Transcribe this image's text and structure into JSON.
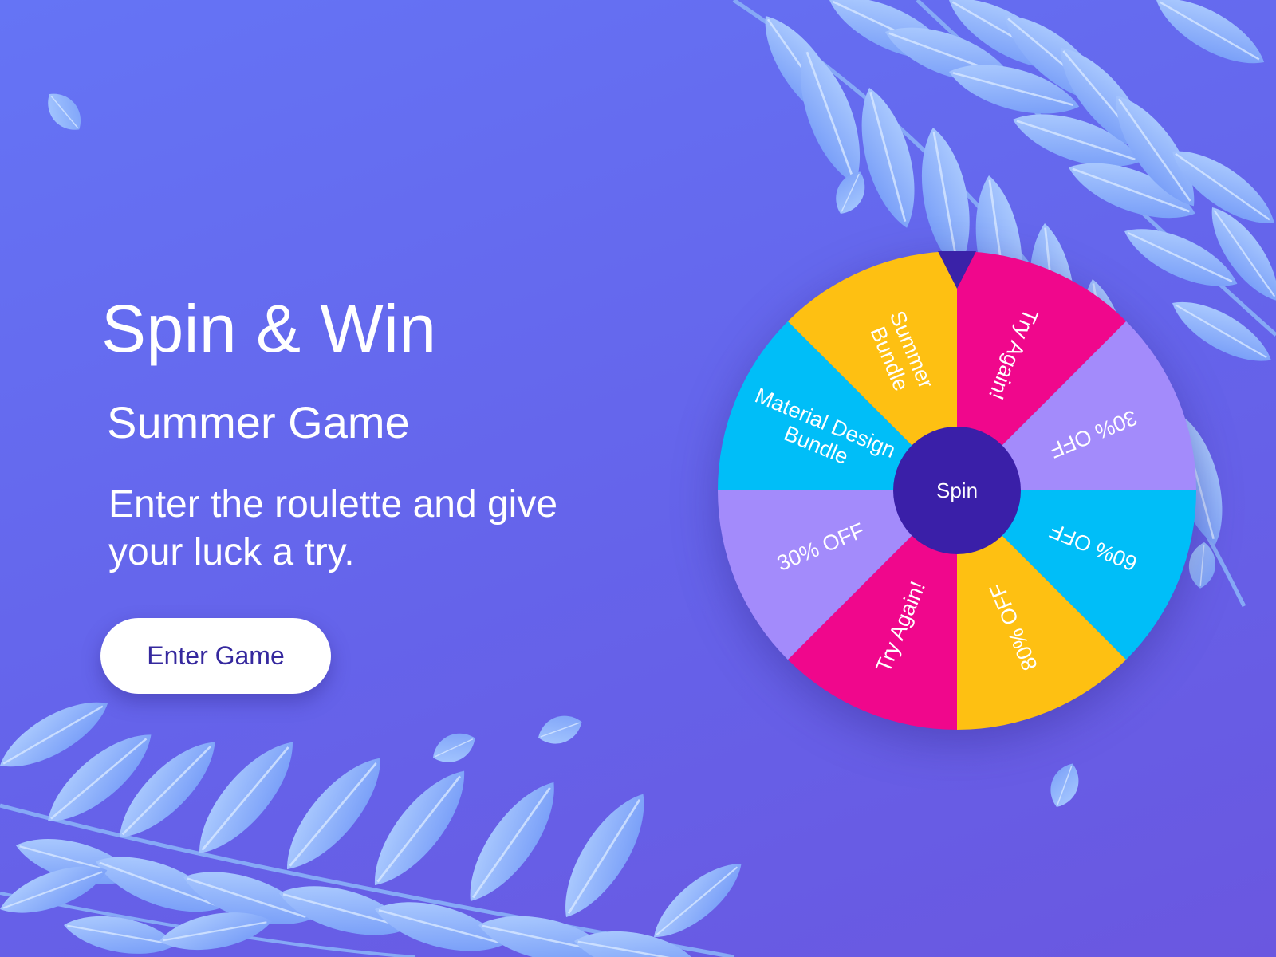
{
  "hero": {
    "title": "Spin & Win",
    "subtitle": "Summer Game",
    "description": "Enter the roulette and give your luck a try.",
    "button_label": "Enter Game"
  },
  "wheel": {
    "center_label": "Spin",
    "pointer_color": "#3a22a8",
    "hub_color": "#3a1fa8",
    "segments": [
      {
        "label_lines": [
          "Try Again!"
        ],
        "color": "#f0078c"
      },
      {
        "label_lines": [
          "30% OFF"
        ],
        "color": "#a38bfb"
      },
      {
        "label_lines": [
          "60% OFF"
        ],
        "color": "#00bef8"
      },
      {
        "label_lines": [
          "80% OFF"
        ],
        "color": "#fec012"
      },
      {
        "label_lines": [
          "Try Again!"
        ],
        "color": "#f0078c"
      },
      {
        "label_lines": [
          "30% OFF"
        ],
        "color": "#a38bfb"
      },
      {
        "label_lines": [
          "Material Design",
          "Bundle"
        ],
        "color": "#00bef8"
      },
      {
        "label_lines": [
          "Summer",
          "Bundle"
        ],
        "color": "#fec012"
      }
    ]
  },
  "palette": {
    "background_top": "#6574f5",
    "background_bottom": "#6a57e0",
    "leaf_light": "#9cc3ff",
    "leaf_mid": "#7aa7ff"
  }
}
